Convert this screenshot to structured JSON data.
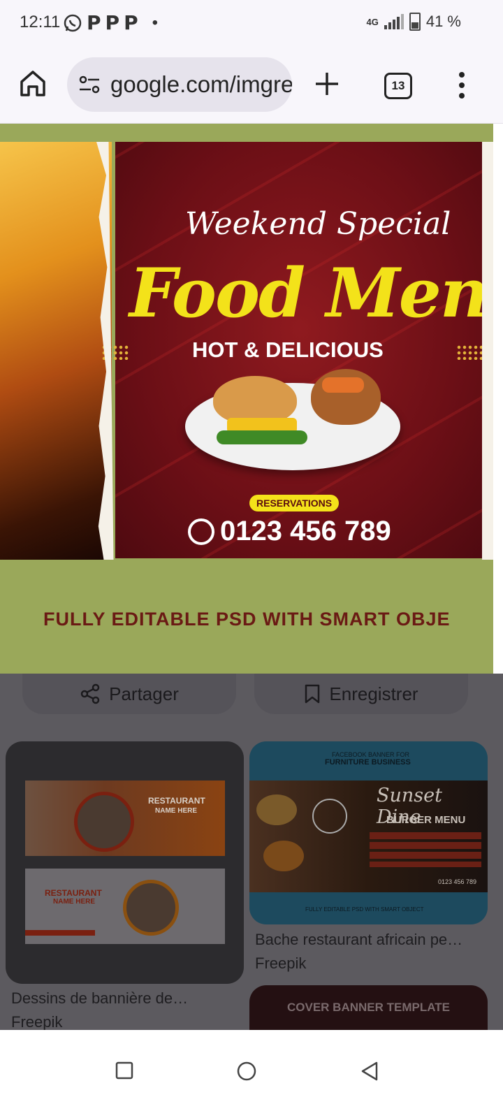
{
  "status_bar": {
    "time": "12:11",
    "battery": "41 %",
    "network": "4G",
    "notification_icons": [
      "whatsapp-icon",
      "p-icon",
      "p-icon",
      "p-icon"
    ]
  },
  "browser": {
    "url": "google.com/imgres",
    "tab_count": "13"
  },
  "hero_image": {
    "line1": "Weekend Special",
    "line2": "Food Menu",
    "line3": "HOT & DELICIOUS",
    "badge": "RESERVATIONS",
    "phone": "0123 456 789",
    "caption": "FULLY EDITABLE PSD WITH SMART OBJE"
  },
  "actions": {
    "share": "Partager",
    "save": "Enregistrer"
  },
  "results": [
    {
      "title": "Dessins de bannière de…",
      "source": "Freepik",
      "image_text": [
        "RESTAURANT",
        "NAME HERE",
        "RESTAURANT",
        "NAME HERE"
      ]
    },
    {
      "title": "Bache restaurant africain pe…",
      "source": "Freepik",
      "image_text": [
        "FACEBOOK BANNER FOR",
        "FURNITURE BUSINESS",
        "Sunset Dine",
        "BURGER MENU",
        "0123 456 789",
        "FULLY EDITABLE PSD WITH SMART OBJECT"
      ]
    },
    {
      "image_text": [
        "COVER BANNER TEMPLATE"
      ]
    }
  ],
  "colors": {
    "accent_red": "#6c0f16",
    "accent_yellow": "#f3e21a",
    "hero_background": "#9aa85a",
    "dim_overlay": "#5c5a5f"
  }
}
